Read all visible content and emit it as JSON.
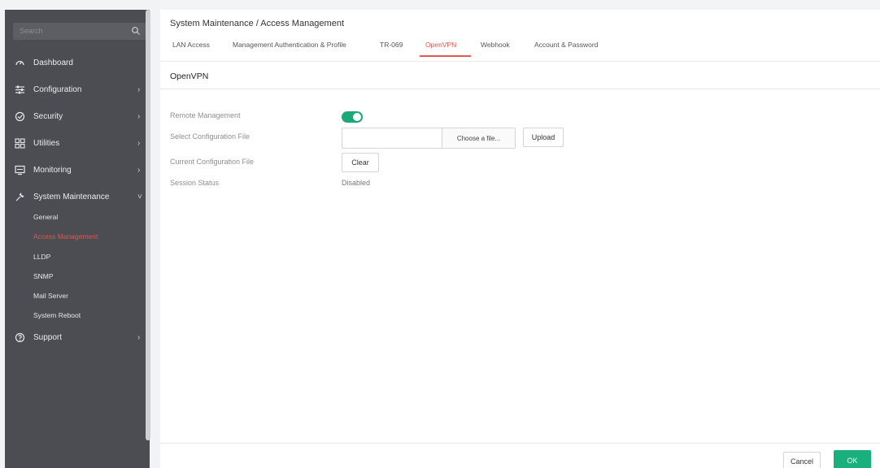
{
  "sidebar": {
    "search_placeholder": "Search",
    "items": [
      {
        "label": "Dashboard",
        "icon": "dashboard-icon"
      },
      {
        "label": "Configuration",
        "icon": "sliders-icon",
        "chevron": "›"
      },
      {
        "label": "Security",
        "icon": "shield-icon",
        "chevron": "›"
      },
      {
        "label": "Utilities",
        "icon": "grid-icon",
        "chevron": "›"
      },
      {
        "label": "Monitoring",
        "icon": "monitor-icon",
        "chevron": "›"
      },
      {
        "label": "System Maintenance",
        "icon": "wrench-icon",
        "chevron": "˅"
      },
      {
        "label": "Support",
        "icon": "help-circle-icon",
        "chevron": "›"
      }
    ],
    "system_maintenance_sub": [
      "General",
      "Access Management",
      "LLDP",
      "SNMP",
      "Mail Server",
      "System Reboot"
    ]
  },
  "header": {
    "breadcrumb": "System Maintenance /  Access Management",
    "tabs": [
      "LAN Access",
      "Management Authentication & Profile",
      "TR-069",
      "OpenVPN",
      "Webhook",
      "Account & Password"
    ],
    "active_tab": "OpenVPN"
  },
  "content": {
    "title": "OpenVPN",
    "labels": {
      "remote_management": "Remote Management",
      "select_config": "Select Configuration File",
      "current_config": "Current Configuration File",
      "session_status": "Session Status"
    },
    "remote_management_enabled": true,
    "choose_file_label": "Choose a file...",
    "upload_label": "Upload",
    "clear_label": "Clear",
    "session_status_value": "Disabled"
  },
  "footer": {
    "cancel_label": "Cancel",
    "ok_label": "OK"
  },
  "colors": {
    "accent": "#19b07d",
    "active_tab": "#e0584f",
    "sidebar_bg": "#4b4d52"
  }
}
